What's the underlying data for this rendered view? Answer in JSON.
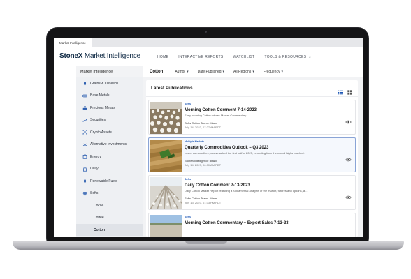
{
  "browser": {
    "tab_label": "Market Intelligence"
  },
  "header": {
    "brand_bold": "StoneX",
    "brand_light": " Market Intelligence",
    "nav": [
      "HOME",
      "INTERACTIVE REPORTS",
      "WATCHLIST",
      "TOOLS & RESOURCES"
    ]
  },
  "sidebar": {
    "title": "Market Intelligence",
    "items": [
      {
        "label": "Grains & Oilseeds",
        "icon": "grain-icon"
      },
      {
        "label": "Base Metals",
        "icon": "link-icon"
      },
      {
        "label": "Precious Metals",
        "icon": "gold-bars-icon"
      },
      {
        "label": "Securities",
        "icon": "line-chart-icon"
      },
      {
        "label": "Crypto Assets",
        "icon": "network-icon"
      },
      {
        "label": "Alternative Investments",
        "icon": "asterisk-icon"
      },
      {
        "label": "Energy",
        "icon": "energy-icon"
      },
      {
        "label": "Dairy",
        "icon": "dairy-icon"
      },
      {
        "label": "Renewable Fuels",
        "icon": "renewable-icon"
      },
      {
        "label": "Softs",
        "icon": "softs-icon"
      }
    ],
    "subitems": [
      "Cocoa",
      "Coffee",
      "Cotton"
    ]
  },
  "filters": {
    "title": "Cotton",
    "items": [
      "Author",
      "Date Published",
      "All Regions",
      "Frequency"
    ]
  },
  "publications": {
    "heading": "Latest Publications",
    "cards": [
      {
        "category": "Softs",
        "title": "Morning Cotton Comment 7-14-2023",
        "description": "Early morning Cotton futures Market Commentary.",
        "author": "Softs Cotton Team - Miami",
        "date": "July 14, 2023, 07:27 AM PDT"
      },
      {
        "category": "Multiple Markets",
        "title": "Quarterly Commodities Outlook – Q3 2023",
        "description": "Lower commodities prices marked the first half of 2023, retreating from the record highs reached.",
        "author": "StoneX Intelligence Brazil",
        "date": "July 14, 2023, 06:00 AM PDT"
      },
      {
        "category": "Softs",
        "title": "Daily Cotton Comment 7-13-2023",
        "description": "Daily Cotton Market Report featuring a fundamental analysis of the market, futures and options, a...",
        "author": "Softs Cotton Team - Miami",
        "date": "July 13, 2023, 01:33 PM PDT"
      },
      {
        "category": "Softs",
        "title": "Morning Cotton Commentary + Export Sales 7-13-23",
        "description": "",
        "author": "",
        "date": ""
      }
    ]
  },
  "colors": {
    "accent": "#1d57b5",
    "brand": "#0a2540",
    "sidebar_bg": "#eef0f3"
  }
}
